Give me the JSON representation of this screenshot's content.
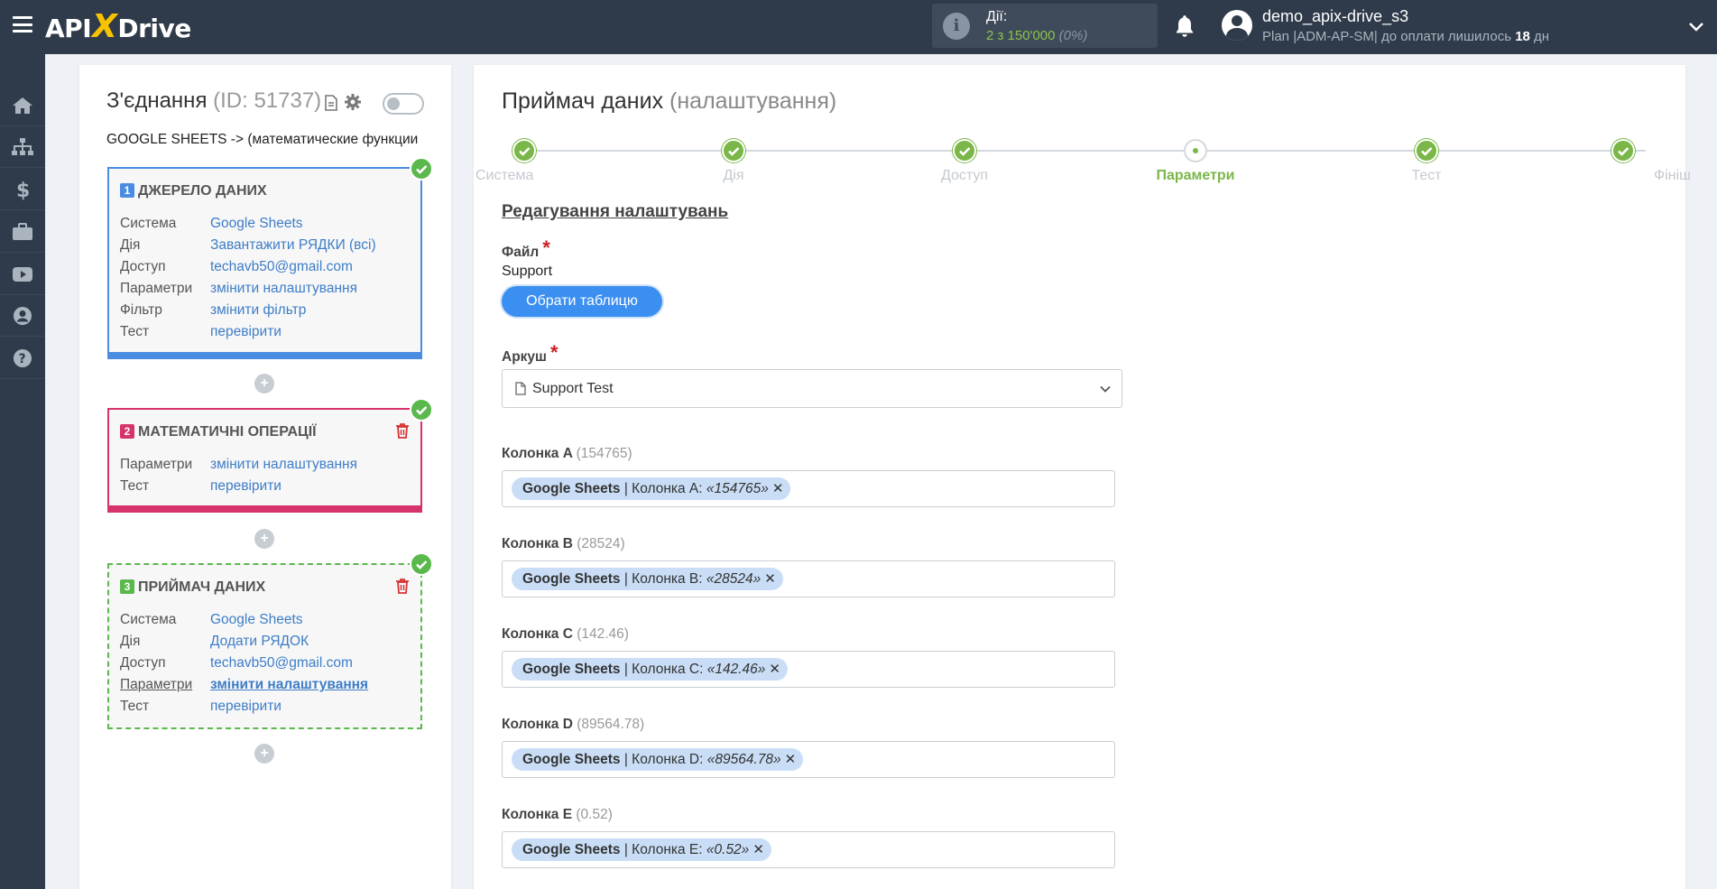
{
  "topbar": {
    "logo": {
      "left": "API",
      "x": "X",
      "right": "Drive"
    },
    "actions_label": "Дії:",
    "actions_count": "2 з 150'000",
    "actions_percent": "(0%)",
    "user_name": "demo_apix-drive_s3",
    "plan_text": "Plan |ADM-AP-SM| до оплати лишилось",
    "plan_days": "18",
    "plan_days_unit": "дн"
  },
  "sidebar": {
    "items": [
      "home-icon",
      "sitemap-icon",
      "dollar-icon",
      "briefcase-icon",
      "youtube-icon",
      "user-icon",
      "help-icon"
    ]
  },
  "connection": {
    "title": "З'єднання",
    "id_text": "(ID: 51737)",
    "name": "GOOGLE SHEETS -> (математические функции"
  },
  "cards": [
    {
      "number": "1",
      "title": "ДЖЕРЕЛО ДАНИХ",
      "rows": [
        {
          "k": "Система",
          "v": "Google Sheets"
        },
        {
          "k": "Дія",
          "v": "Завантажити РЯДКИ (всі)"
        },
        {
          "k": "Доступ",
          "v": "techavb50@gmail.com"
        },
        {
          "k": "Параметри",
          "v": "змінити налаштування"
        },
        {
          "k": "Фільтр",
          "v": "змінити фільтр"
        },
        {
          "k": "Тест",
          "v": "перевірити"
        }
      ]
    },
    {
      "number": "2",
      "title": "МАТЕМАТИЧНІ ОПЕРАЦІЇ",
      "rows": [
        {
          "k": "Параметри",
          "v": "змінити налаштування"
        },
        {
          "k": "Тест",
          "v": "перевірити"
        }
      ]
    },
    {
      "number": "3",
      "title": "ПРИЙМАЧ ДАНИХ",
      "rows": [
        {
          "k": "Система",
          "v": "Google Sheets"
        },
        {
          "k": "Дія",
          "v": "Додати РЯДОК"
        },
        {
          "k": "Доступ",
          "v": "techavb50@gmail.com"
        },
        {
          "k": "Параметри",
          "v": "змінити налаштування"
        },
        {
          "k": "Тест",
          "v": "перевірити"
        }
      ]
    }
  ],
  "plus_label": "+",
  "main": {
    "title": "Приймач даних",
    "title_suffix": "(налаштування)",
    "steps": [
      {
        "label": "Система",
        "state": "done"
      },
      {
        "label": "Дія",
        "state": "done"
      },
      {
        "label": "Доступ",
        "state": "done"
      },
      {
        "label": "Параметри",
        "state": "current"
      },
      {
        "label": "Тест",
        "state": "done"
      },
      {
        "label": "Фініш",
        "state": "done"
      }
    ],
    "section_title": "Редагування налаштувань",
    "file_label": "Файл",
    "required_mark": "*",
    "file_value": "Support",
    "select_table_button": "Обрати таблицю",
    "sheet_label": "Аркуш",
    "sheet_value": "Support Test",
    "columns": [
      {
        "label": "Колонка A",
        "hint": "(154765)",
        "tag_source": "Google Sheets",
        "tag_text": "| Колонка A:",
        "tag_value": "«154765»"
      },
      {
        "label": "Колонка B",
        "hint": "(28524)",
        "tag_source": "Google Sheets",
        "tag_text": "| Колонка B:",
        "tag_value": "«28524»"
      },
      {
        "label": "Колонка C",
        "hint": "(142.46)",
        "tag_source": "Google Sheets",
        "tag_text": "| Колонка C:",
        "tag_value": "«142.46»"
      },
      {
        "label": "Колонка D",
        "hint": "(89564.78)",
        "tag_source": "Google Sheets",
        "tag_text": "| Колонка D:",
        "tag_value": "«89564.78»"
      },
      {
        "label": "Колонка E",
        "hint": "(0.52)",
        "tag_source": "Google Sheets",
        "tag_text": "| Колонка E:",
        "tag_value": "«0.52»"
      }
    ],
    "tag_remove": "✕"
  },
  "colors": {
    "topbar_bg": "#2f3b4a",
    "accent_blue": "#3b8ff0",
    "success_green": "#7ab648",
    "danger_red": "#d6336c"
  }
}
